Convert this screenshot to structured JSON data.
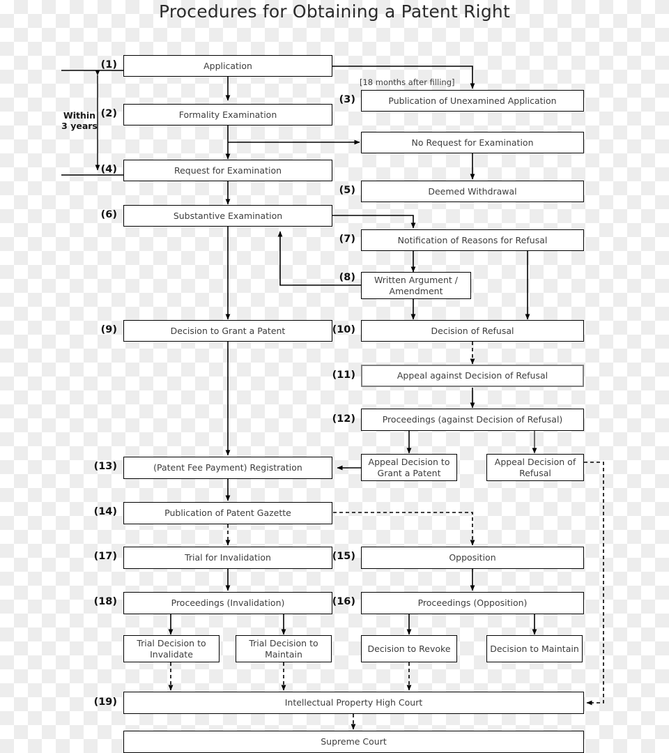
{
  "title": "Procedures for Obtaining a Patent Right",
  "bracket": {
    "label_line1": "Within",
    "label_line2": "3 years"
  },
  "annotations": {
    "publication_delay": "[18 months after filling]"
  },
  "nodes": [
    {
      "id": "application",
      "num": "(1)",
      "label": "Application"
    },
    {
      "id": "formality",
      "num": "(2)",
      "label": "Formality Examination"
    },
    {
      "id": "publication_unexam",
      "num": "(3)",
      "label": "Publication of Unexamined Application"
    },
    {
      "id": "no_request",
      "num": "",
      "label": "No Request for Examination"
    },
    {
      "id": "request_exam",
      "num": "(4)",
      "label": "Request for Examination"
    },
    {
      "id": "deemed_withdrawal",
      "num": "(5)",
      "label": "Deemed Withdrawal"
    },
    {
      "id": "substantive",
      "num": "(6)",
      "label": "Substantive Examination"
    },
    {
      "id": "notification",
      "num": "(7)",
      "label": "Notification of Reasons for Refusal"
    },
    {
      "id": "written_argument",
      "num": "(8)",
      "label": "Written Argument / Amendment"
    },
    {
      "id": "decision_grant",
      "num": "(9)",
      "label": "Decision to Grant a Patent"
    },
    {
      "id": "decision_refusal",
      "num": "(10)",
      "label": "Decision of Refusal"
    },
    {
      "id": "appeal_against",
      "num": "(11)",
      "label": "Appeal against Decision of Refusal"
    },
    {
      "id": "proceedings_refusal",
      "num": "(12)",
      "label": "Proceedings (against Decision of Refusal)"
    },
    {
      "id": "appeal_dec_grant",
      "num": "",
      "label": "Appeal Decision to Grant a Patent"
    },
    {
      "id": "appeal_dec_refusal",
      "num": "",
      "label": "Appeal Decision of Refusal"
    },
    {
      "id": "registration",
      "num": "(13)",
      "label": "(Patent Fee Payment) Registration"
    },
    {
      "id": "gazette",
      "num": "(14)",
      "label": "Publication of Patent Gazette"
    },
    {
      "id": "trial_invalidation",
      "num": "(17)",
      "label": "Trial for Invalidation"
    },
    {
      "id": "opposition",
      "num": "(15)",
      "label": "Opposition"
    },
    {
      "id": "proc_invalidation",
      "num": "(18)",
      "label": "Proceedings (Invalidation)"
    },
    {
      "id": "proc_opposition",
      "num": "(16)",
      "label": "Proceedings (Opposition)"
    },
    {
      "id": "trial_invalidate",
      "num": "",
      "label": "Trial Decision to Invalidate"
    },
    {
      "id": "trial_maintain",
      "num": "",
      "label": "Trial Decision to Maintain"
    },
    {
      "id": "decision_revoke",
      "num": "",
      "label": "Decision to Revoke"
    },
    {
      "id": "decision_maintain",
      "num": "",
      "label": "Decision to Maintain"
    },
    {
      "id": "ip_high_court",
      "num": "(19)",
      "label": "Intellectual Property High Court"
    },
    {
      "id": "supreme_court",
      "num": "",
      "label": "Supreme Court"
    }
  ],
  "colors": {
    "line": "#000000",
    "box_border": "#000000",
    "gray_border": "#808080",
    "text": "#3d3d3d",
    "title": "#2b2b2b",
    "background_light": "#ffffff",
    "background_dark": "#ededed"
  }
}
